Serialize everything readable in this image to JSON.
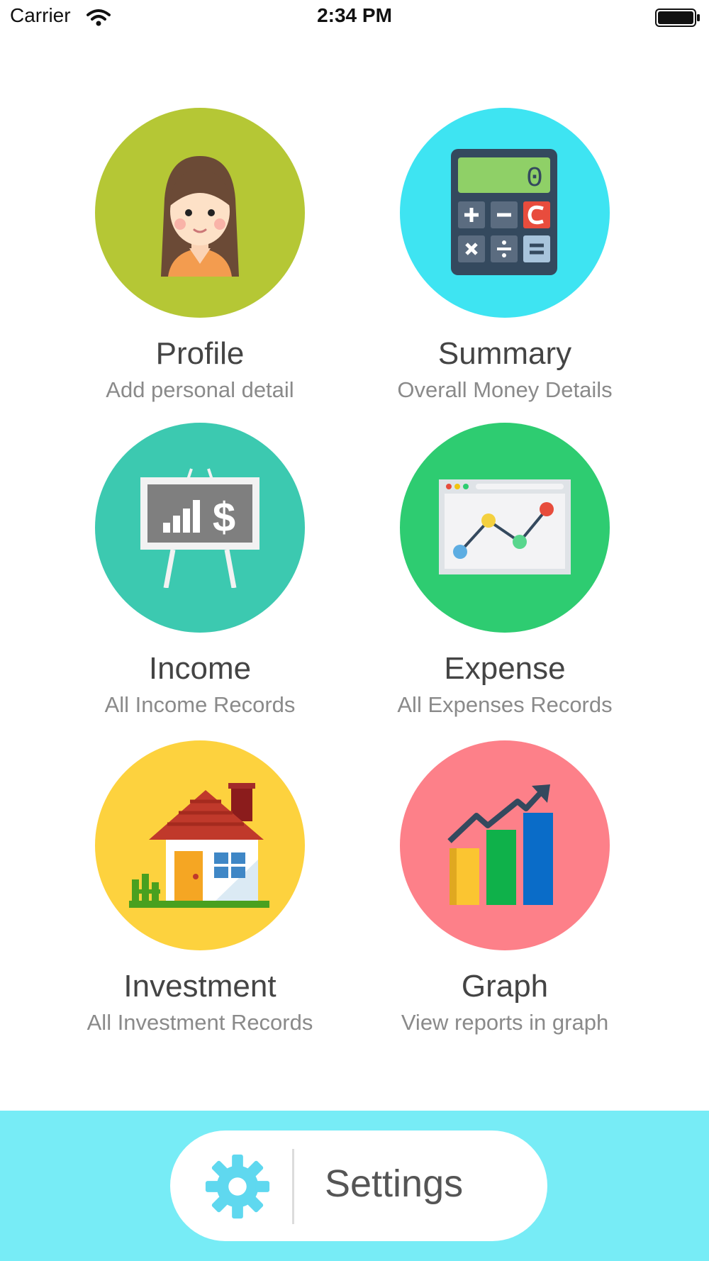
{
  "status_bar": {
    "carrier": "Carrier",
    "time": "2:34 PM",
    "wifi_icon": "wifi-icon",
    "battery_icon": "battery-icon"
  },
  "menu": [
    {
      "title": "Profile",
      "subtitle": "Add personal detail",
      "icon": "person-avatar-icon",
      "color": "#b5c735"
    },
    {
      "title": "Summary",
      "subtitle": "Overall Money Details",
      "icon": "calculator-icon",
      "color": "#3ee4f2"
    },
    {
      "title": "Income",
      "subtitle": "All Income Records",
      "icon": "income-easel-icon",
      "color": "#3cc9b0"
    },
    {
      "title": "Expense",
      "subtitle": "All Expenses Records",
      "icon": "line-chart-browser-icon",
      "color": "#2ecc71"
    },
    {
      "title": "Investment",
      "subtitle": "All Investment Records",
      "icon": "house-icon",
      "color": "#fdd23e"
    },
    {
      "title": "Graph",
      "subtitle": "View reports in graph",
      "icon": "bar-chart-icon",
      "color": "#fd8089"
    }
  ],
  "calculator_display": "0",
  "settings": {
    "label": "Settings",
    "icon": "gear-icon",
    "bar_color": "#77ecf6",
    "gear_color": "#5fd8ef"
  }
}
